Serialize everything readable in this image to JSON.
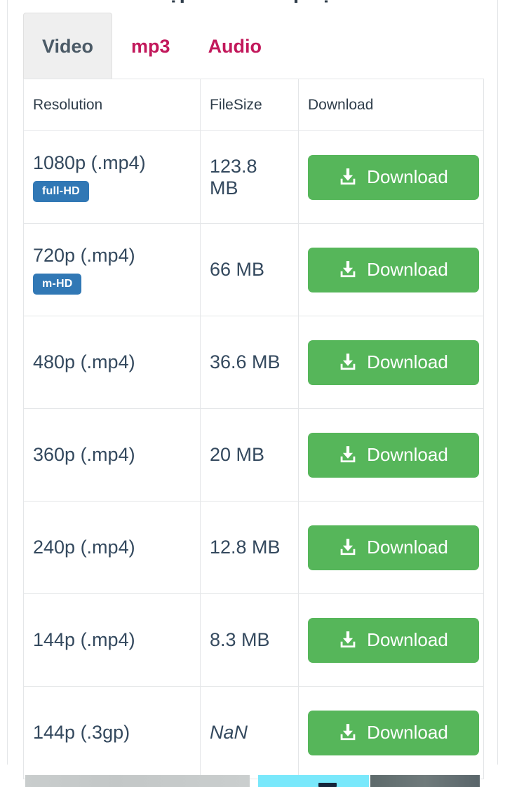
{
  "page": {
    "clipped_title": "tệp âm để tiếp tục",
    "bg_color": "#ffffff",
    "text_color": "#2f3d4a"
  },
  "tabs": {
    "active_index": 0,
    "active_color": "#4b5a66",
    "active_bg": "#efefef",
    "inactive_color": "#c2185b",
    "items": [
      {
        "label": "Video",
        "active": true
      },
      {
        "label": "mp3",
        "active": false
      },
      {
        "label": "Audio",
        "active": false
      }
    ]
  },
  "table": {
    "columns": [
      "Resolution",
      "FileSize",
      "Download"
    ],
    "button_color": "#56b65a",
    "badge_color": "#3178b5",
    "download_icon": "download-arrow-tray-icon",
    "rows": [
      {
        "resolution": "1080p (.mp4)",
        "badge": "full-HD",
        "filesize": "123.8 MB",
        "filesize_nan": false,
        "download_label": "Download"
      },
      {
        "resolution": "720p (.mp4)",
        "badge": "m-HD",
        "filesize": "66 MB",
        "filesize_nan": false,
        "download_label": "Download"
      },
      {
        "resolution": "480p (.mp4)",
        "badge": null,
        "filesize": "36.6 MB",
        "filesize_nan": false,
        "download_label": "Download"
      },
      {
        "resolution": "360p (.mp4)",
        "badge": null,
        "filesize": "20 MB",
        "filesize_nan": false,
        "download_label": "Download"
      },
      {
        "resolution": "240p (.mp4)",
        "badge": null,
        "filesize": "12.8 MB",
        "filesize_nan": false,
        "download_label": "Download"
      },
      {
        "resolution": "144p (.mp4)",
        "badge": null,
        "filesize": "8.3 MB",
        "filesize_nan": false,
        "download_label": "Download"
      },
      {
        "resolution": "144p (.3gp)",
        "badge": null,
        "filesize": "NaN",
        "filesize_nan": true,
        "download_label": "Download"
      }
    ]
  },
  "thumbnails": [
    {
      "name": "thumbnail-gray",
      "color": "#c6caca"
    },
    {
      "name": "thumbnail-cyan",
      "color": "#79e8fb"
    },
    {
      "name": "thumbnail-dark",
      "color": "#647072"
    }
  ]
}
